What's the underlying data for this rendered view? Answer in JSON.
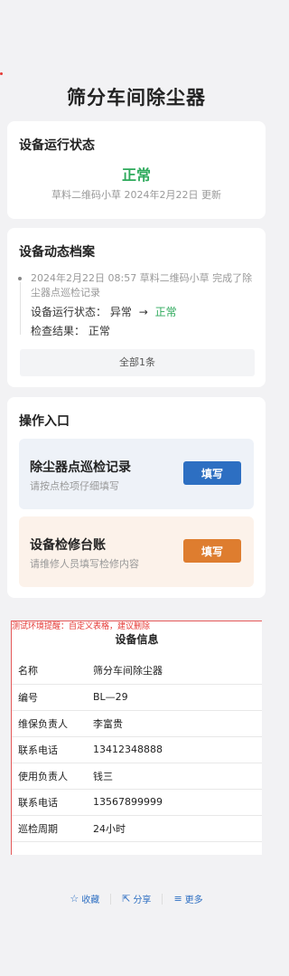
{
  "page": {
    "title": "筛分车间除尘器"
  },
  "status": {
    "title": "设备运行状态",
    "value": "正常",
    "meta": "草料二维码小草 2024年2月22日 更新"
  },
  "records": {
    "title": "设备动态档案",
    "item": {
      "text": "2024年2月22日 08:57  草料二维码小草 完成了除尘器点巡检记录",
      "status_label": "设备运行状态：",
      "from": "异常",
      "arrow": "→",
      "to": "正常",
      "result_label": "检查结果：",
      "result_value": "正常"
    },
    "view_all": "全部1条"
  },
  "entries": {
    "title": "操作入口",
    "items": [
      {
        "title": "除尘器点巡检记录",
        "subtitle": "请按点检项仔细填写",
        "button": "填写",
        "color": "#2d6fc2"
      },
      {
        "title": "设备检修台账",
        "subtitle": "请维修人员填写检修内容",
        "button": "填写",
        "color": "#de7d2f"
      }
    ]
  },
  "device": {
    "warning": "测试环境提醒：自定义表格，建议删除",
    "title": "设备信息",
    "rows": [
      {
        "key": "名称",
        "value": "筛分车间除尘器"
      },
      {
        "key": "编号",
        "value": "BL—29"
      },
      {
        "key": "维保负责人",
        "value": "李富贵"
      },
      {
        "key": "联系电话",
        "value": "13412348888"
      },
      {
        "key": "使用负责人",
        "value": "钱三"
      },
      {
        "key": "联系电话",
        "value": "13567899999"
      },
      {
        "key": "巡检周期",
        "value": "24小时"
      }
    ]
  },
  "footer": {
    "favorite": "收藏",
    "share": "分享",
    "more": "更多",
    "favorite_icon": "☆",
    "share_icon": "⇱",
    "more_icon": "≡"
  }
}
